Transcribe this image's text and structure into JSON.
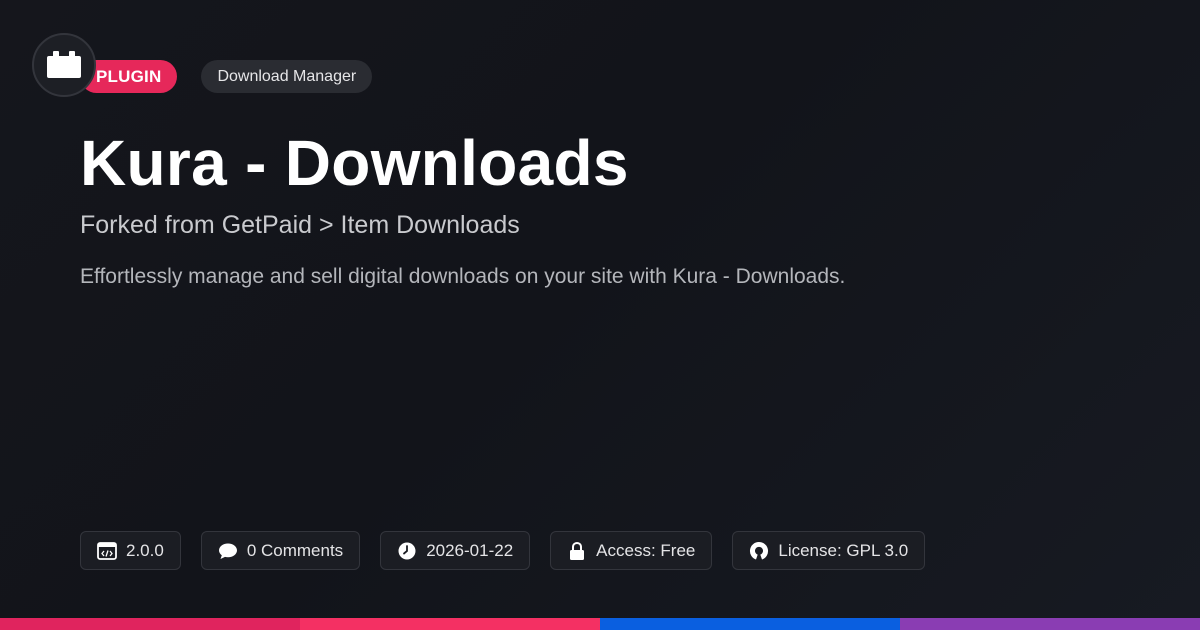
{
  "header": {
    "type_badge": "PLUGIN",
    "category_badge": "Download Manager"
  },
  "title": "Kura - Downloads",
  "subtitle": "Forked from GetPaid > Item Downloads",
  "description": "Effortlessly manage and sell digital downloads on your site with Kura - Downloads.",
  "meta": {
    "version": {
      "icon": "code-window-icon",
      "label": "2.0.0"
    },
    "comments": {
      "icon": "comment-bubble-icon",
      "label": "0 Comments"
    },
    "date": {
      "icon": "clock-icon",
      "label": "2026-01-22"
    },
    "access": {
      "icon": "lock-icon",
      "label": "Access: Free"
    },
    "license": {
      "icon": "open-source-icon",
      "label": "License: GPL 3.0"
    }
  },
  "colors": {
    "accent": "#e6285a",
    "bar_1": "#e0245e",
    "bar_2": "#f43063",
    "bar_3": "#0a5fe0",
    "bar_4": "#8a3db3"
  }
}
